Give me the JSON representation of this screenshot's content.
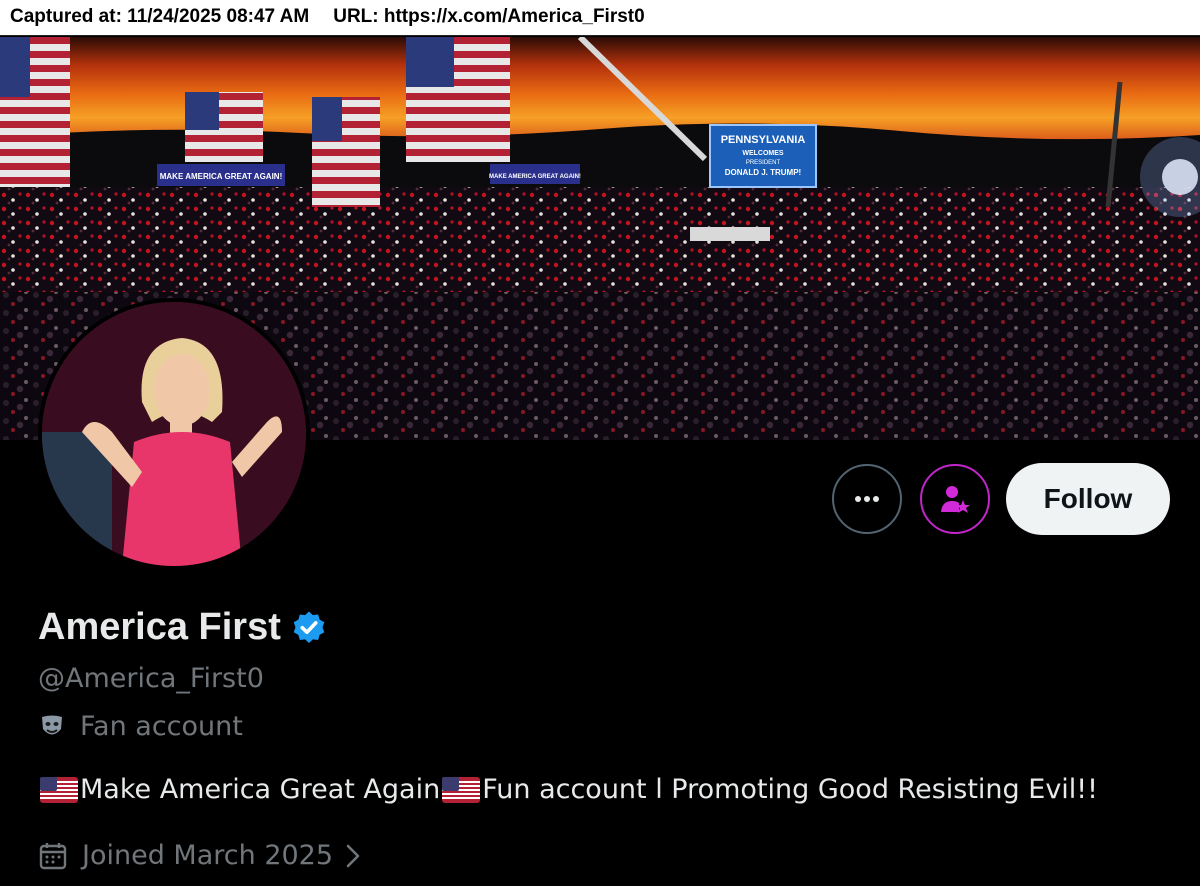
{
  "capture": {
    "captured_label": "Captured at: 11/24/2025 08:47 AM",
    "url_label": "URL: https://x.com/America_First0"
  },
  "banner": {
    "sign_left": "MAKE AMERICA GREAT AGAIN!",
    "sign_center": "MAKE AMERICA GREAT AGAIN!",
    "screen_line1": "PENNSYLVANIA",
    "screen_line2": "WELCOMES",
    "screen_line3": "PRESIDENT",
    "screen_line4": "DONALD J. TRUMP!"
  },
  "actions": {
    "more_icon": "more-horizontal-icon",
    "subscribe_icon": "subscribe-person-star-icon",
    "follow_label": "Follow"
  },
  "profile": {
    "name": "America First",
    "handle": "@America_First0",
    "label": "Fan account",
    "bio_part1": "Make America Great Again",
    "bio_part2": " Fun account l Promoting Good Resisting Evil!!",
    "joined": "Joined March 2025"
  },
  "colors": {
    "background": "#000000",
    "verified": "#1d9bf0",
    "subscribe_accent": "#c026c8",
    "muted_text": "#71767b"
  }
}
